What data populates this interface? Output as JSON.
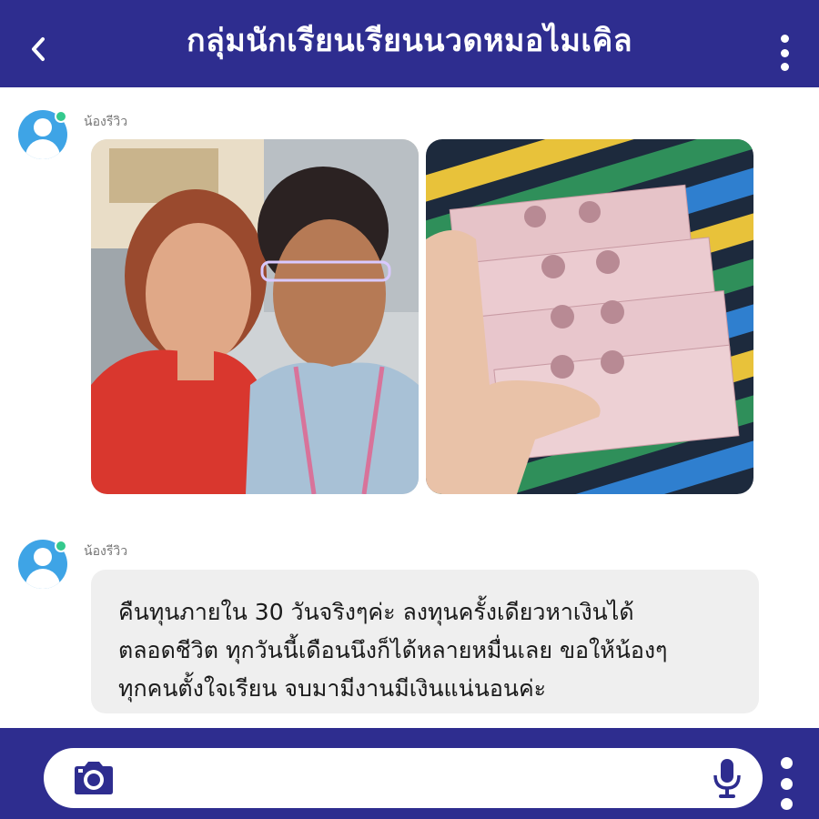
{
  "header": {
    "title": "กลุ่มนักเรียนเรียนนวดหมอไมเคิล",
    "back_icon": "chevron-left-icon",
    "menu_icon": "more-vertical-icon"
  },
  "messages": [
    {
      "sender": "น้องรีวิว",
      "type": "photos",
      "photos": [
        "selfie-photo",
        "banknotes-photo"
      ]
    },
    {
      "sender": "น้องรีวิว",
      "type": "text",
      "text": "คืนทุนภายใน 30 วันจริงๆค่ะ ลงทุนครั้งเดียวหาเงินได้\nตลอดชีวิต ทุกวันนี้เดือนนึงก็ได้หลายหมื่นเลย ขอให้น้องๆ\nทุกคนตั้งใจเรียน จบมามีงานมีเงินแน่นอนค่ะ"
    }
  ],
  "composer": {
    "camera_icon": "camera-icon",
    "mic_icon": "microphone-icon",
    "menu_icon": "more-vertical-icon"
  },
  "colors": {
    "brand": "#2e2d8f",
    "avatar": "#3ea4e6",
    "online": "#34c98d",
    "bubble": "#efefef"
  }
}
